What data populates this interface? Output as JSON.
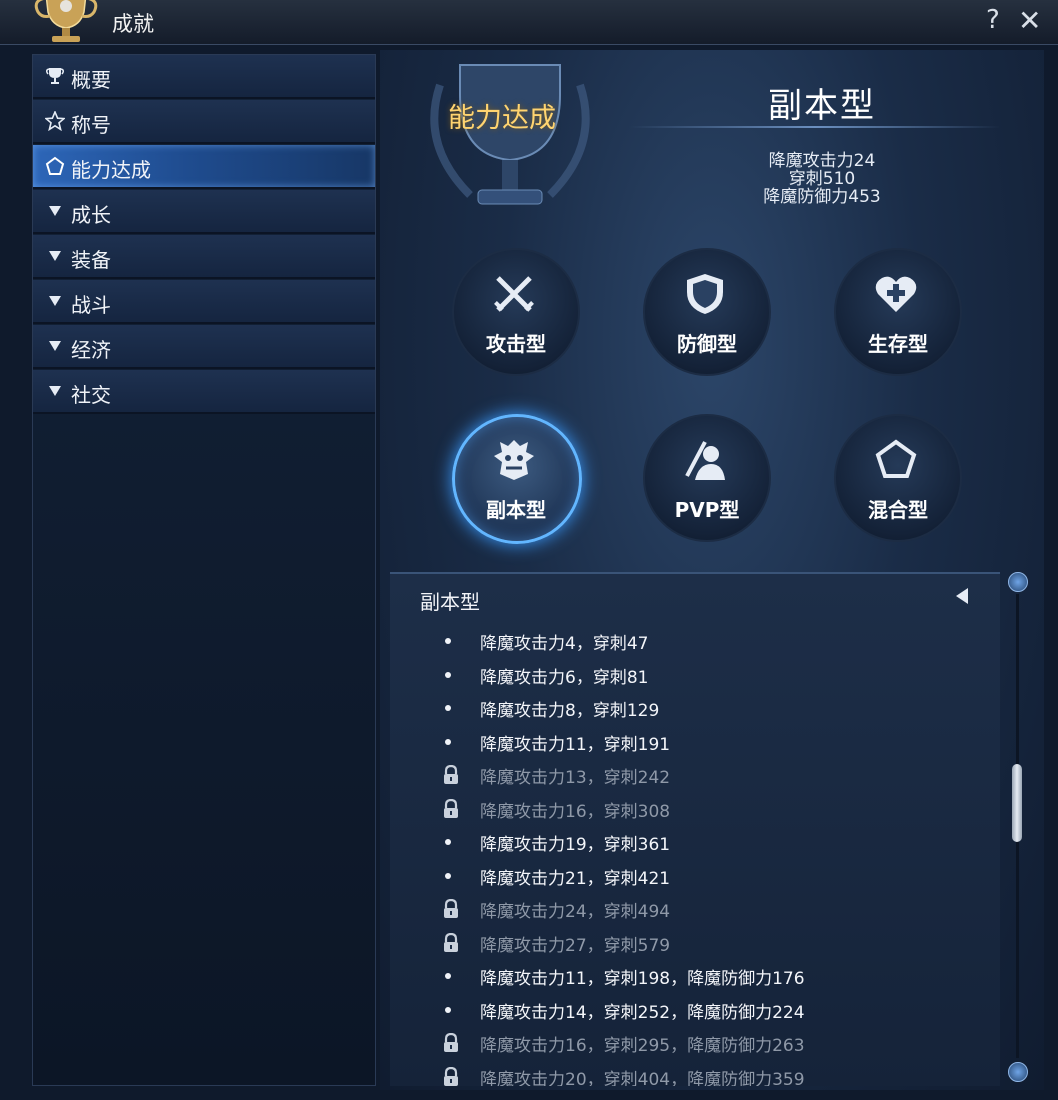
{
  "window": {
    "title": "成就",
    "help_label": "?",
    "close_label": "✕"
  },
  "sidebar": {
    "items": [
      {
        "label": "概要",
        "icon": "trophy-icon",
        "active": false
      },
      {
        "label": "称号",
        "icon": "star-icon",
        "active": false
      },
      {
        "label": "能力达成",
        "icon": "pentagon-icon",
        "active": true
      },
      {
        "label": "成长",
        "icon": "triangle-down-icon",
        "active": false
      },
      {
        "label": "装备",
        "icon": "triangle-down-icon",
        "active": false
      },
      {
        "label": "战斗",
        "icon": "triangle-down-icon",
        "active": false
      },
      {
        "label": "经济",
        "icon": "triangle-down-icon",
        "active": false
      },
      {
        "label": "社交",
        "icon": "triangle-down-icon",
        "active": false
      }
    ]
  },
  "header": {
    "section_heading": "能力达成",
    "selected_type": "副本型",
    "stats": [
      "降魔攻击力24",
      "穿刺510",
      "降魔防御力453"
    ]
  },
  "types": [
    {
      "label": "攻击型",
      "icon": "crossed-swords-icon",
      "selected": false
    },
    {
      "label": "防御型",
      "icon": "shield-icon",
      "selected": false
    },
    {
      "label": "生存型",
      "icon": "heart-plus-icon",
      "selected": false
    },
    {
      "label": "副本型",
      "icon": "demon-mask-icon",
      "selected": true
    },
    {
      "label": "PVP型",
      "icon": "fighter-icon",
      "selected": false
    },
    {
      "label": "混合型",
      "icon": "pentagon-icon",
      "selected": false
    }
  ],
  "list": {
    "title": "副本型",
    "rows": [
      {
        "text": "降魔攻击力4，穿刺47",
        "locked": false
      },
      {
        "text": "降魔攻击力6，穿刺81",
        "locked": false
      },
      {
        "text": "降魔攻击力8，穿刺129",
        "locked": false
      },
      {
        "text": "降魔攻击力11，穿刺191",
        "locked": false
      },
      {
        "text": "降魔攻击力13，穿刺242",
        "locked": true
      },
      {
        "text": "降魔攻击力16，穿刺308",
        "locked": true
      },
      {
        "text": "降魔攻击力19，穿刺361",
        "locked": false
      },
      {
        "text": "降魔攻击力21，穿刺421",
        "locked": false
      },
      {
        "text": "降魔攻击力24，穿刺494",
        "locked": true
      },
      {
        "text": "降魔攻击力27，穿刺579",
        "locked": true
      },
      {
        "text": "降魔攻击力11，穿刺198，降魔防御力176",
        "locked": false
      },
      {
        "text": "降魔攻击力14，穿刺252，降魔防御力224",
        "locked": false
      },
      {
        "text": "降魔攻击力16，穿刺295，降魔防御力263",
        "locked": true
      },
      {
        "text": "降魔攻击力20，穿刺404，降魔防御力359",
        "locked": true
      }
    ]
  },
  "colors": {
    "accent": "#62b6ff",
    "heading_gold": "#ffd470",
    "locked_text": "#8f99a8"
  }
}
